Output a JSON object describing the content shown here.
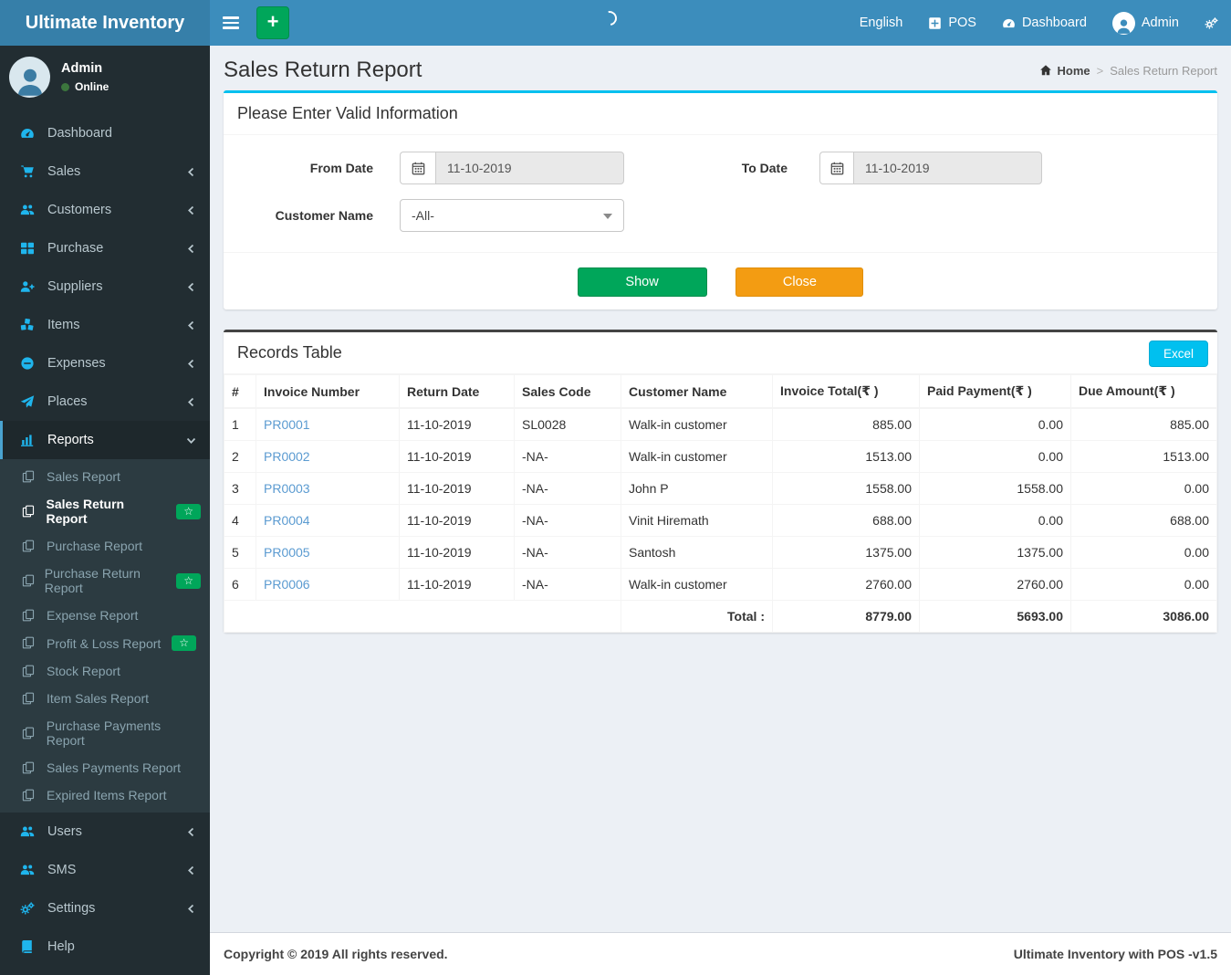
{
  "app": {
    "brand": "Ultimate Inventory",
    "footer_left": "Copyright © 2019 All rights reserved.",
    "footer_right": "Ultimate Inventory with POS -v1.5"
  },
  "navbar": {
    "add_label": "+",
    "language": "English",
    "pos_label": "POS",
    "dashboard_label": "Dashboard",
    "user_label": "Admin"
  },
  "sidebar": {
    "user": {
      "name": "Admin",
      "status": "Online"
    },
    "items_top": [
      {
        "label": "Dashboard",
        "icon": "tachometer-icon",
        "chevron": false
      },
      {
        "label": "Sales",
        "icon": "cart-icon",
        "chevron": true
      },
      {
        "label": "Customers",
        "icon": "users-icon",
        "chevron": true
      },
      {
        "label": "Purchase",
        "icon": "grid-icon",
        "chevron": true
      },
      {
        "label": "Suppliers",
        "icon": "user-plus-icon",
        "chevron": true
      },
      {
        "label": "Items",
        "icon": "cubes-icon",
        "chevron": true
      },
      {
        "label": "Expenses",
        "icon": "minus-circle-icon",
        "chevron": true
      },
      {
        "label": "Places",
        "icon": "paper-plane-icon",
        "chevron": true
      }
    ],
    "reports": {
      "label": "Reports",
      "icon": "bar-chart-icon",
      "children": [
        {
          "label": "Sales Report",
          "icon": "copy-icon"
        },
        {
          "label": "Sales Return Report",
          "icon": "copy-icon",
          "active": true,
          "badge": "☆"
        },
        {
          "label": "Purchase Report",
          "icon": "copy-icon"
        },
        {
          "label": "Purchase Return Report",
          "icon": "copy-icon",
          "badge": "☆"
        },
        {
          "label": "Expense Report",
          "icon": "copy-icon"
        },
        {
          "label": "Profit & Loss Report",
          "icon": "copy-icon",
          "badge": "☆"
        },
        {
          "label": "Stock Report",
          "icon": "copy-icon"
        },
        {
          "label": "Item Sales Report",
          "icon": "copy-icon"
        },
        {
          "label": "Purchase Payments Report",
          "icon": "copy-icon"
        },
        {
          "label": "Sales Payments Report",
          "icon": "copy-icon"
        },
        {
          "label": "Expired Items Report",
          "icon": "copy-icon"
        }
      ]
    },
    "items_bottom": [
      {
        "label": "Users",
        "icon": "users-icon",
        "chevron": true
      },
      {
        "label": "SMS",
        "icon": "users-icon",
        "chevron": true
      },
      {
        "label": "Settings",
        "icon": "cogs-icon",
        "chevron": true
      },
      {
        "label": "Help",
        "icon": "book-icon",
        "chevron": false
      }
    ]
  },
  "page": {
    "title": "Sales Return Report",
    "breadcrumb_home": "Home",
    "breadcrumb_current": "Sales Return Report"
  },
  "filter": {
    "heading": "Please Enter Valid Information",
    "from_label": "From Date",
    "from_value": "11-10-2019",
    "to_label": "To Date",
    "to_value": "11-10-2019",
    "customer_label": "Customer Name",
    "customer_value": "-All-",
    "show_label": "Show",
    "close_label": "Close"
  },
  "records": {
    "heading": "Records Table",
    "excel_label": "Excel",
    "columns": [
      "#",
      "Invoice Number",
      "Return Date",
      "Sales Code",
      "Customer Name",
      "Invoice Total(₹ )",
      "Paid Payment(₹ )",
      "Due Amount(₹ )"
    ],
    "rows": [
      {
        "num": "1",
        "invoice": "PR0001",
        "return_date": "11-10-2019",
        "sales_code": "SL0028",
        "sales_code_link": true,
        "customer": "Walk-in customer",
        "invoice_total": "885.00",
        "paid": "0.00",
        "due": "885.00"
      },
      {
        "num": "2",
        "invoice": "PR0002",
        "return_date": "11-10-2019",
        "sales_code": "-NA-",
        "sales_code_link": false,
        "customer": "Walk-in customer",
        "invoice_total": "1513.00",
        "paid": "0.00",
        "due": "1513.00"
      },
      {
        "num": "3",
        "invoice": "PR0003",
        "return_date": "11-10-2019",
        "sales_code": "-NA-",
        "sales_code_link": false,
        "customer": "John P",
        "invoice_total": "1558.00",
        "paid": "1558.00",
        "due": "0.00"
      },
      {
        "num": "4",
        "invoice": "PR0004",
        "return_date": "11-10-2019",
        "sales_code": "-NA-",
        "sales_code_link": false,
        "customer": "Vinit Hiremath",
        "invoice_total": "688.00",
        "paid": "0.00",
        "due": "688.00"
      },
      {
        "num": "5",
        "invoice": "PR0005",
        "return_date": "11-10-2019",
        "sales_code": "-NA-",
        "sales_code_link": false,
        "customer": "Santosh",
        "invoice_total": "1375.00",
        "paid": "1375.00",
        "due": "0.00"
      },
      {
        "num": "6",
        "invoice": "PR0006",
        "return_date": "11-10-2019",
        "sales_code": "-NA-",
        "sales_code_link": false,
        "customer": "Walk-in customer",
        "invoice_total": "2760.00",
        "paid": "2760.00",
        "due": "0.00"
      }
    ],
    "total_label": "Total :",
    "total_invoice": "8779.00",
    "total_paid": "5693.00",
    "total_due": "3086.00"
  },
  "colors": {
    "navbar": "#3c8dbc",
    "logo": "#367fa9",
    "sidebar": "#222d32",
    "cyan": "#00c0ef",
    "green": "#00a65a",
    "orange": "#f39c12"
  }
}
